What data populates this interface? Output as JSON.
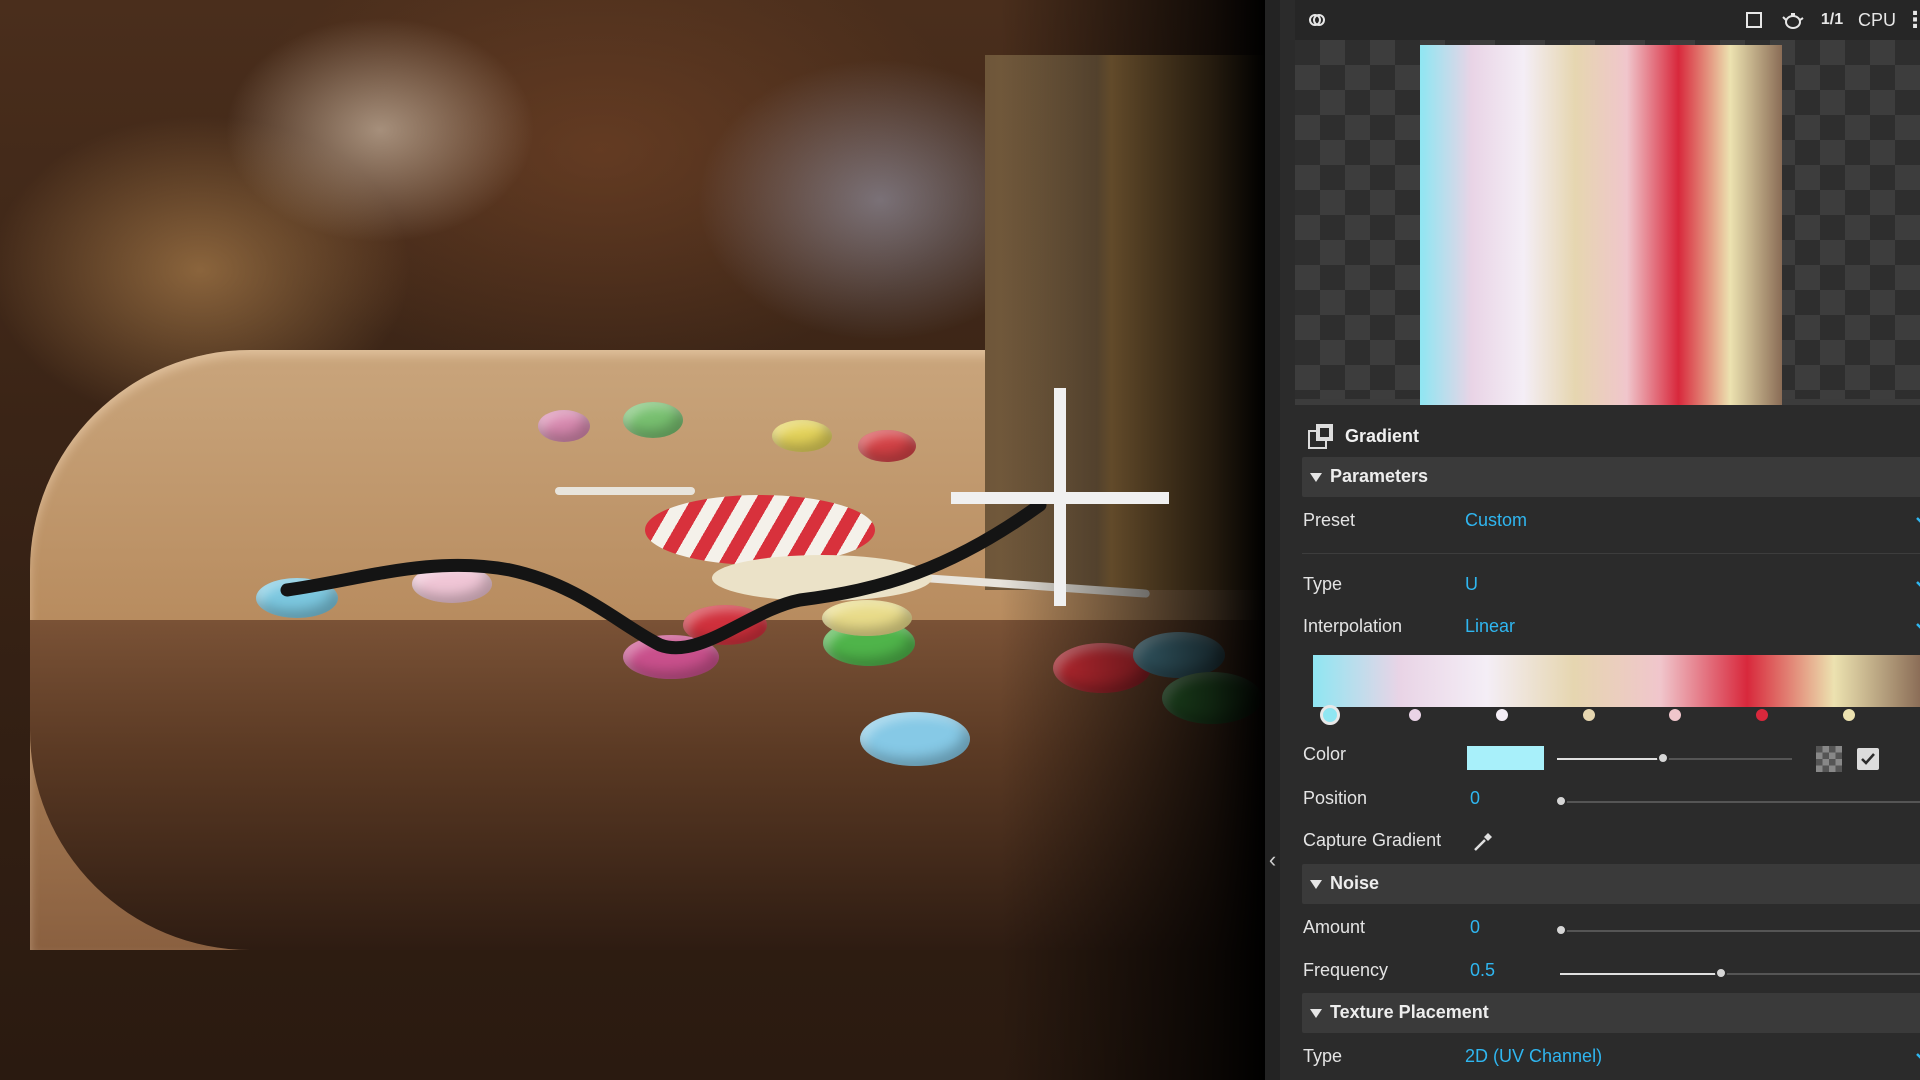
{
  "toolbar": {
    "cpu_label": "CPU",
    "ratio_label": "1/1"
  },
  "panel": {
    "node_title": "Gradient",
    "parameters": {
      "section_label": "Parameters",
      "preset_label": "Preset",
      "preset_value": "Custom",
      "type_label": "Type",
      "type_value": "U",
      "interpolation_label": "Interpolation",
      "interpolation_value": "Linear",
      "color_label": "Color",
      "color_swatch": "#a8f0fa",
      "color_slider": 0.45,
      "position_label": "Position",
      "position_value": "0",
      "capture_label": "Capture Gradient"
    },
    "gradient_stops": [
      {
        "pos": 0.0,
        "color": "#8fe6f2"
      },
      {
        "pos": 0.143,
        "color": "#e9d4e6"
      },
      {
        "pos": 0.286,
        "color": "#f4eef6"
      },
      {
        "pos": 0.429,
        "color": "#e6d6b0"
      },
      {
        "pos": 0.571,
        "color": "#f0c6cc"
      },
      {
        "pos": 0.714,
        "color": "#d8283c"
      },
      {
        "pos": 0.857,
        "color": "#ece2b0"
      },
      {
        "pos": 1.0,
        "color": "#8a6c56"
      }
    ],
    "noise": {
      "section_label": "Noise",
      "amount_label": "Amount",
      "amount_value": "0",
      "amount_slider": 0.0,
      "frequency_label": "Frequency",
      "frequency_value": "0.5",
      "frequency_slider": 0.5
    },
    "texture_placement": {
      "section_label": "Texture Placement",
      "type_label": "Type",
      "type_value": "2D (UV Channel)"
    }
  },
  "colors": {
    "accent": "#2fb6f0",
    "panel_bg": "#2b2b2b",
    "section_bg": "#3a3a3a"
  }
}
